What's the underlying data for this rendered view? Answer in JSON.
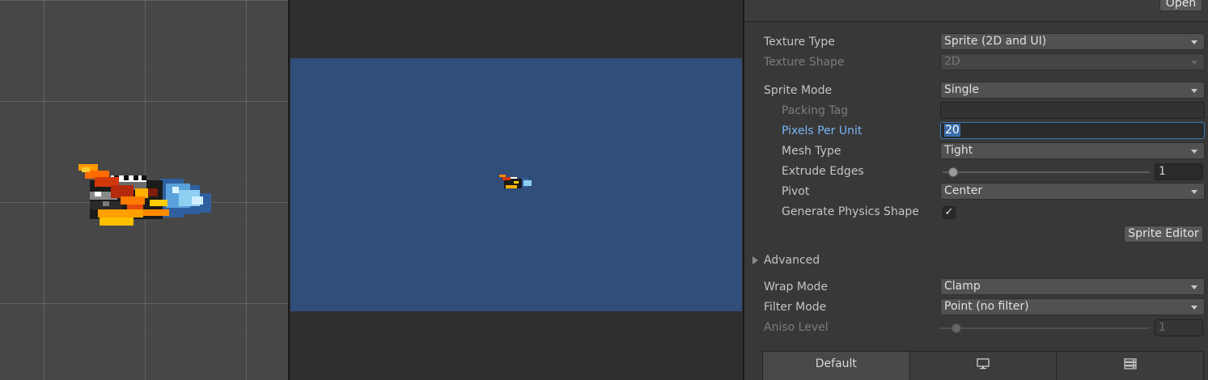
{
  "sprite_preview": {
    "sprite_icon": "spaceship-sprite"
  },
  "game_view": {
    "background_color": "#314d79"
  },
  "inspector": {
    "open_button": "Open",
    "texture_type": {
      "label": "Texture Type",
      "value": "Sprite (2D and UI)"
    },
    "texture_shape": {
      "label": "Texture Shape",
      "value": "2D"
    },
    "sprite_mode": {
      "label": "Sprite Mode",
      "value": "Single"
    },
    "packing_tag": {
      "label": "Packing Tag",
      "value": ""
    },
    "pixels_per_unit": {
      "label": "Pixels Per Unit",
      "value": "20"
    },
    "mesh_type": {
      "label": "Mesh Type",
      "value": "Tight"
    },
    "extrude_edges": {
      "label": "Extrude Edges",
      "value": "1"
    },
    "pivot": {
      "label": "Pivot",
      "value": "Center"
    },
    "generate_physics_shape": {
      "label": "Generate Physics Shape",
      "checked": true,
      "check_glyph": "✓"
    },
    "sprite_editor_button": "Sprite Editor",
    "advanced": {
      "label": "Advanced",
      "expanded": false
    },
    "wrap_mode": {
      "label": "Wrap Mode",
      "value": "Clamp"
    },
    "filter_mode": {
      "label": "Filter Mode",
      "value": "Point (no filter)"
    },
    "aniso_level": {
      "label": "Aniso Level",
      "value": "1"
    },
    "platform_tabs": [
      {
        "label": "Default",
        "icon": ""
      },
      {
        "label": "",
        "icon": "monitor-icon"
      },
      {
        "label": "",
        "icon": "server-icon"
      }
    ]
  }
}
